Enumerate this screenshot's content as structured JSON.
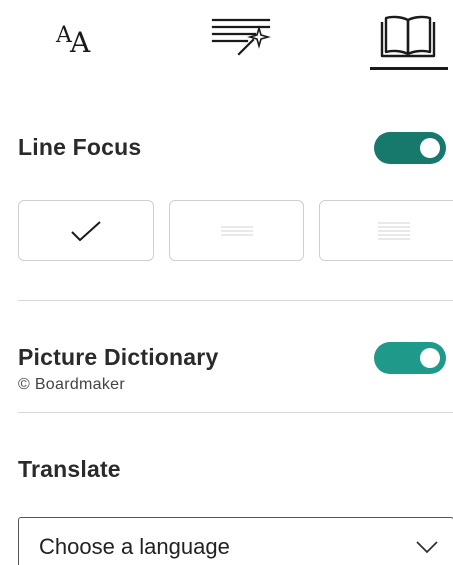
{
  "tabs": [
    {
      "id": "text-preferences",
      "icon": "text-size-icon"
    },
    {
      "id": "grammar-options",
      "icon": "grammar-magic-icon"
    },
    {
      "id": "reading-preferences",
      "icon": "open-book-icon",
      "selected": true
    }
  ],
  "line_focus": {
    "title": "Line Focus",
    "enabled": true,
    "toggle_color": "#17786c",
    "options": [
      {
        "icon": "checkmark-icon",
        "selected": true
      },
      {
        "icon": "three-lines-icon"
      },
      {
        "icon": "five-lines-icon"
      }
    ]
  },
  "picture_dictionary": {
    "title": "Picture Dictionary",
    "credit": "© Boardmaker",
    "enabled": true,
    "toggle_color": "#1f9a8a"
  },
  "translate": {
    "title": "Translate",
    "language_select": {
      "value": "Choose a language",
      "icon": "chevron-down-icon"
    }
  }
}
